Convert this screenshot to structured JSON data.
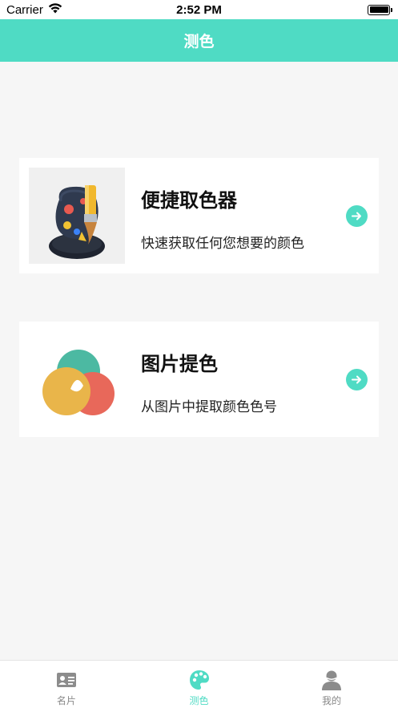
{
  "status_bar": {
    "carrier": "Carrier",
    "time": "2:52 PM"
  },
  "nav": {
    "title": "测色"
  },
  "cards": [
    {
      "title": "便捷取色器",
      "description": "快速获取任何您想要的颜色",
      "icon": "palette-brush-icon"
    },
    {
      "title": "图片提色",
      "description": "从图片中提取颜色色号",
      "icon": "color-circles-icon"
    }
  ],
  "tabs": [
    {
      "label": "名片",
      "icon": "id-card-icon",
      "active": false
    },
    {
      "label": "测色",
      "icon": "palette-icon",
      "active": true
    },
    {
      "label": "我的",
      "icon": "user-icon",
      "active": false
    }
  ],
  "colors": {
    "accent": "#4fdbc4",
    "background": "#f6f6f6",
    "tab_inactive": "#888888"
  }
}
